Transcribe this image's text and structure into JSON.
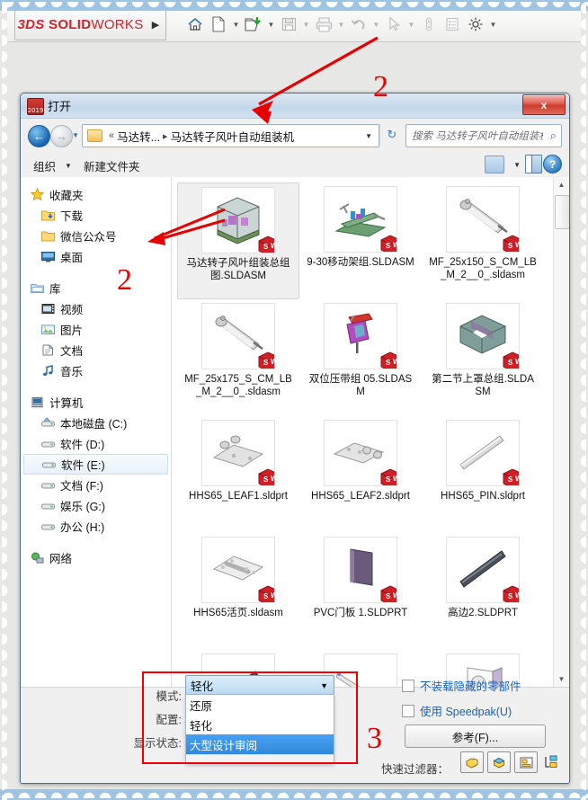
{
  "app": {
    "brand_ds": "3DS",
    "brand_solid": "SOLID",
    "brand_works": "WORKS",
    "flyout_caret": "▶",
    "toolbar": [
      {
        "name": "home-icon",
        "label": "⌂",
        "caret": false,
        "enabled": true
      },
      {
        "name": "new-document-icon",
        "label": "⬜",
        "caret": true,
        "enabled": true
      },
      {
        "name": "open-file-icon",
        "label": "⬜",
        "caret": true,
        "enabled": true
      },
      {
        "name": "save-icon",
        "label": "⬜",
        "caret": true,
        "enabled": false
      },
      {
        "name": "print-icon",
        "label": "⬜",
        "caret": true,
        "enabled": false
      },
      {
        "name": "undo-icon",
        "label": "↶",
        "caret": true,
        "enabled": false
      },
      {
        "name": "select-cursor-icon",
        "label": "➤",
        "caret": true,
        "enabled": false
      },
      {
        "name": "rebuild-icon",
        "label": "⬜",
        "caret": false,
        "enabled": false
      },
      {
        "name": "options-list-icon",
        "label": "⬜",
        "caret": false,
        "enabled": false
      },
      {
        "name": "settings-gear-icon",
        "label": "⚙",
        "caret": true,
        "enabled": true
      }
    ]
  },
  "dialog": {
    "title": "打开",
    "icon_year": "2019",
    "close_label": "x",
    "nav": {
      "back_glyph": "←",
      "forward_glyph": "→",
      "recent_caret": "▼",
      "breadcrumb_root": "«",
      "breadcrumb_parent": "马达转...",
      "breadcrumb_sep": "▸",
      "breadcrumb_current": "马达转子风叶自动组装机",
      "addr_caret": "▼",
      "refresh_glyph": "↻",
      "search_placeholder": "搜索 马达转子风叶自动组装机",
      "search_icon": "⌕"
    },
    "commandbar": {
      "organize": "组织",
      "organize_caret": "▼",
      "new_folder": "新建文件夹",
      "view_caret": "▼",
      "help_glyph": "?"
    },
    "navpane": [
      {
        "name": "favorites",
        "label": "收藏夹",
        "icon": "star-icon",
        "level": 0,
        "selected": false,
        "gap_before": false
      },
      {
        "name": "downloads",
        "label": "下载",
        "icon": "folder-download-icon",
        "level": 1,
        "selected": false,
        "gap_before": false
      },
      {
        "name": "wechat-official",
        "label": "微信公众号",
        "icon": "folder-icon",
        "level": 1,
        "selected": false,
        "gap_before": false
      },
      {
        "name": "desktop",
        "label": "桌面",
        "icon": "desktop-icon",
        "level": 1,
        "selected": false,
        "gap_before": false
      },
      {
        "name": "libraries",
        "label": "库",
        "icon": "library-icon",
        "level": 0,
        "selected": false,
        "gap_before": true
      },
      {
        "name": "videos",
        "label": "视频",
        "icon": "video-icon",
        "level": 1,
        "selected": false,
        "gap_before": false
      },
      {
        "name": "pictures",
        "label": "图片",
        "icon": "picture-icon",
        "level": 1,
        "selected": false,
        "gap_before": false
      },
      {
        "name": "documents",
        "label": "文档",
        "icon": "document-icon",
        "level": 1,
        "selected": false,
        "gap_before": false
      },
      {
        "name": "music",
        "label": "音乐",
        "icon": "music-icon",
        "level": 1,
        "selected": false,
        "gap_before": false
      },
      {
        "name": "computer",
        "label": "计算机",
        "icon": "computer-icon",
        "level": 0,
        "selected": false,
        "gap_before": true
      },
      {
        "name": "drive-c",
        "label": "本地磁盘 (C:)",
        "icon": "harddisk-system-icon",
        "level": 1,
        "selected": false,
        "gap_before": false
      },
      {
        "name": "drive-d",
        "label": "软件 (D:)",
        "icon": "harddisk-icon",
        "level": 1,
        "selected": false,
        "gap_before": false
      },
      {
        "name": "drive-e",
        "label": "软件 (E:)",
        "icon": "harddisk-icon",
        "level": 1,
        "selected": true,
        "gap_before": false
      },
      {
        "name": "drive-f",
        "label": "文档 (F:)",
        "icon": "harddisk-icon",
        "level": 1,
        "selected": false,
        "gap_before": false
      },
      {
        "name": "drive-g",
        "label": "娱乐 (G:)",
        "icon": "harddisk-icon",
        "level": 1,
        "selected": false,
        "gap_before": false
      },
      {
        "name": "drive-h",
        "label": "办公 (H:)",
        "icon": "harddisk-icon",
        "level": 1,
        "selected": false,
        "gap_before": false
      },
      {
        "name": "network",
        "label": "网络",
        "icon": "network-icon",
        "level": 0,
        "selected": false,
        "gap_before": true
      }
    ],
    "files": [
      {
        "name": "马达转子风叶组装总组图.SLDASM",
        "thumb": "machine-cabinet",
        "selected": true
      },
      {
        "name": "9-30移动架组.SLDASM",
        "thumb": "rail-assembly",
        "selected": false
      },
      {
        "name": "MF_25x150_S_CM_LB_M_2__0_.sldasm",
        "thumb": "cylinder",
        "selected": false
      },
      {
        "name": "MF_25x175_S_CM_LB_M_2__0_.sldasm",
        "thumb": "cylinder",
        "selected": false
      },
      {
        "name": "双位压带组 05.SLDASM",
        "thumb": "press-unit",
        "selected": false
      },
      {
        "name": "第二节上罩总组.SLDASM",
        "thumb": "enclosure",
        "selected": false
      },
      {
        "name": "HHS65_LEAF1.sldprt",
        "thumb": "hinge-leaf1",
        "selected": false
      },
      {
        "name": "HHS65_LEAF2.sldprt",
        "thumb": "hinge-leaf2",
        "selected": false
      },
      {
        "name": "HHS65_PIN.sldprt",
        "thumb": "pin-rod",
        "selected": false
      },
      {
        "name": "HHS65活页.sldasm",
        "thumb": "hinge-assembly",
        "selected": false
      },
      {
        "name": "PVC门板 1.SLDPRT",
        "thumb": "panel",
        "selected": false
      },
      {
        "name": "高边2.SLDPRT",
        "thumb": "dark-rod",
        "selected": false
      },
      {
        "name": "",
        "thumb": "dark-rod2",
        "selected": false
      },
      {
        "name": "",
        "thumb": "thin-rod",
        "selected": false
      },
      {
        "name": "",
        "thumb": "block-hole",
        "selected": false
      }
    ],
    "scrollbar": {
      "up": "▲",
      "down": "▼"
    },
    "footer": {
      "mode_label": "模式:",
      "mode_value": "轻化",
      "config_label": "配置:",
      "config_value": "",
      "display_state_label": "显示状态:",
      "display_state_value": "",
      "combo_caret": "▼",
      "mode_options": [
        {
          "label": "还原",
          "highlighted": false
        },
        {
          "label": "轻化",
          "highlighted": false
        },
        {
          "label": "大型设计审阅",
          "highlighted": true
        }
      ],
      "checkbox_no_hidden": "不装载隐藏的零部件",
      "checkbox_speedpak": "使用 Speedpak(U)",
      "reference_button": "参考(F)...",
      "quick_filter_label": "快速过滤器：",
      "quick_filters": [
        {
          "name": "filter-part-icon"
        },
        {
          "name": "filter-assembly-icon"
        },
        {
          "name": "filter-drawing-icon"
        },
        {
          "name": "filter-toplevel-icon"
        }
      ]
    }
  },
  "annotations": [
    {
      "name": "callout-2-toolbar",
      "text": "2"
    },
    {
      "name": "callout-2-navpane",
      "text": "2"
    },
    {
      "name": "callout-3-mode",
      "text": "3"
    }
  ],
  "colors": {
    "accent_red": "#e60000",
    "link_blue": "#1a63b8",
    "brand_red": "#d2232a",
    "selection_blue": "#2f8ae0"
  }
}
